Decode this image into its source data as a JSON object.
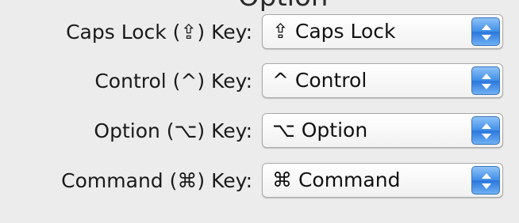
{
  "header_clip": "Option",
  "rows": [
    {
      "label": "Caps Lock (⇪) Key:",
      "value": "⇪ Caps Lock"
    },
    {
      "label": "Control (^) Key:",
      "value": "^ Control"
    },
    {
      "label": "Option (⌥) Key:",
      "value": "⌥ Option"
    },
    {
      "label": "Command (⌘) Key:",
      "value": "⌘ Command"
    }
  ],
  "icons": {
    "popup_arrows": "up-down-arrows-icon"
  }
}
